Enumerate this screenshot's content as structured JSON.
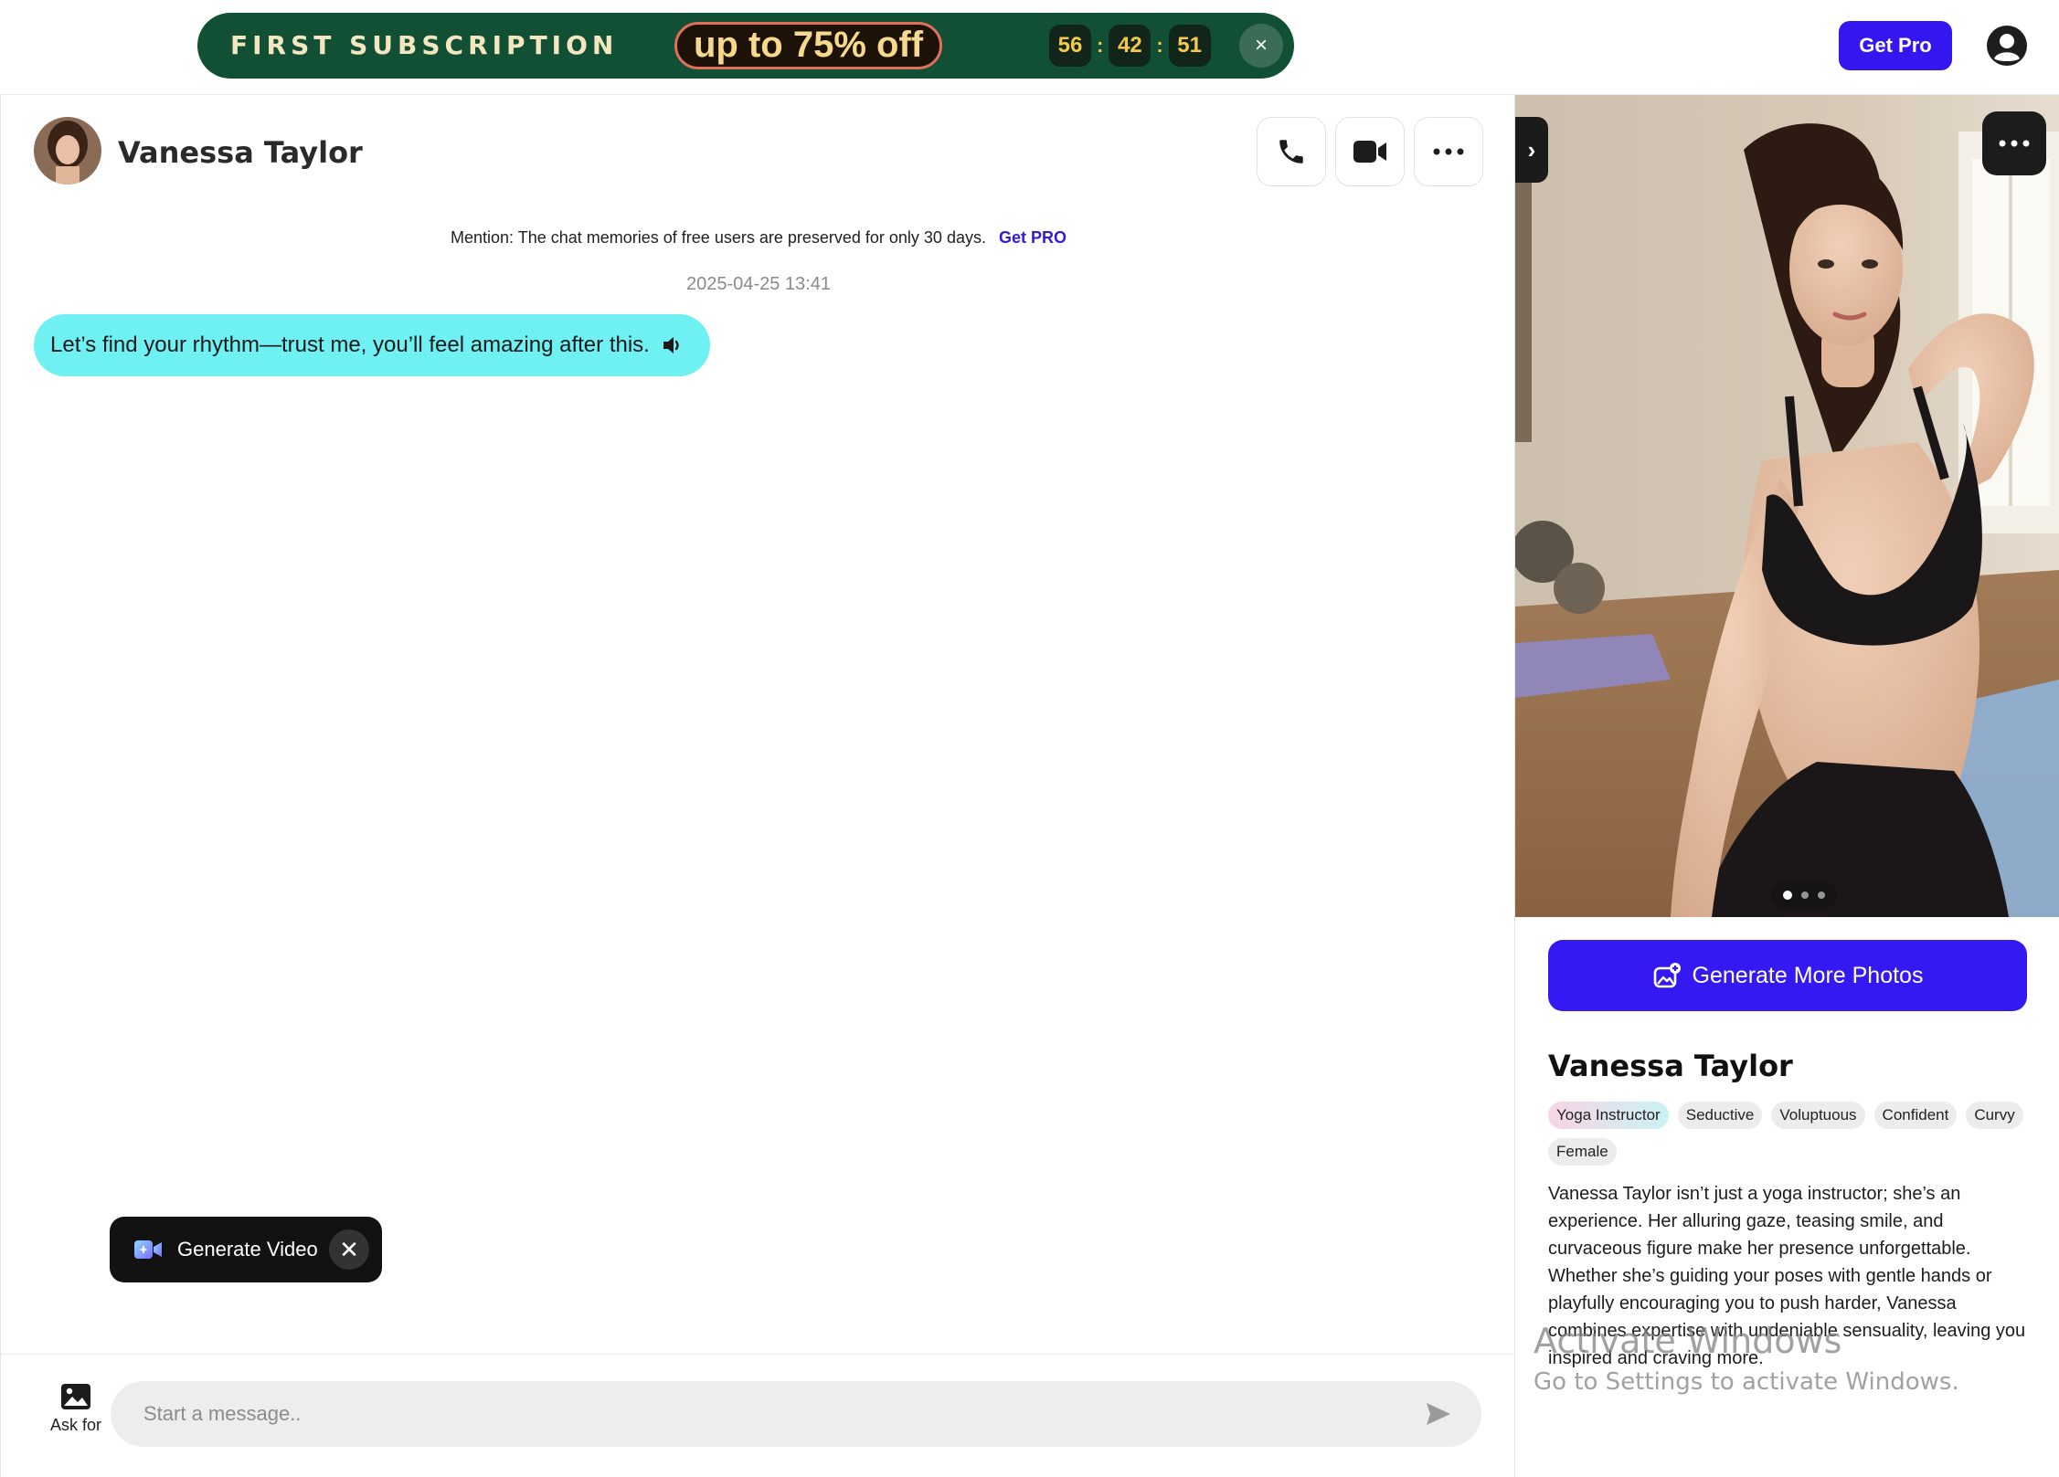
{
  "promo": {
    "title": "FIRST SUBSCRIPTION",
    "deal": "up to 75% off",
    "timer": {
      "hours": "56",
      "minutes": "42",
      "seconds": "51",
      "separator": ":"
    },
    "close_glyph": "×"
  },
  "topbar": {
    "get_pro_label": "Get Pro",
    "user_icon": "user-circle-icon"
  },
  "chat": {
    "character_name": "Vanessa Taylor",
    "header_icons": [
      "phone-icon",
      "video-camera-icon",
      "more-horizontal-icon"
    ],
    "mention_text": "Mention: The chat memories of free users are preserved for only 30 days.",
    "mention_link": "Get PRO",
    "timestamp": "2025-04-25 13:41",
    "messages": [
      {
        "sender": "Vanessa Taylor",
        "text": "Let’s find your rhythm—trust me, you’ll feel amazing after this.",
        "icon": "speaker-icon"
      }
    ],
    "generate_video_label": "Generate Video",
    "generate_video_close": "✕",
    "ask_for_label": "Ask for",
    "composer_placeholder": "Start a message.."
  },
  "profile": {
    "collapse_glyph": "›",
    "photo_pagination": {
      "count": 3,
      "active": 1
    },
    "generate_photos_label": "Generate More Photos",
    "name": "Vanessa Taylor",
    "tags": [
      "Yoga Instructor",
      "Seductive",
      "Voluptuous",
      "Confident",
      "Curvy",
      "Female"
    ],
    "description": "Vanessa Taylor isn’t just a yoga instructor; she’s an experience. Her alluring gaze, teasing smile, and curvaceous figure make her presence unforgettable. Whether she’s guiding your poses with gentle hands or playfully encouraging you to push harder, Vanessa combines expertise with undeniable sensuality, leaving you inspired and craving more."
  },
  "os_watermark": {
    "line1": "Activate Windows",
    "line2": "Go to Settings to activate Windows."
  },
  "colors": {
    "accent": "#3417f0",
    "promo_bg": "#115035",
    "bubble": "#6ff0f2",
    "timer_digits": "#f6c94a"
  }
}
